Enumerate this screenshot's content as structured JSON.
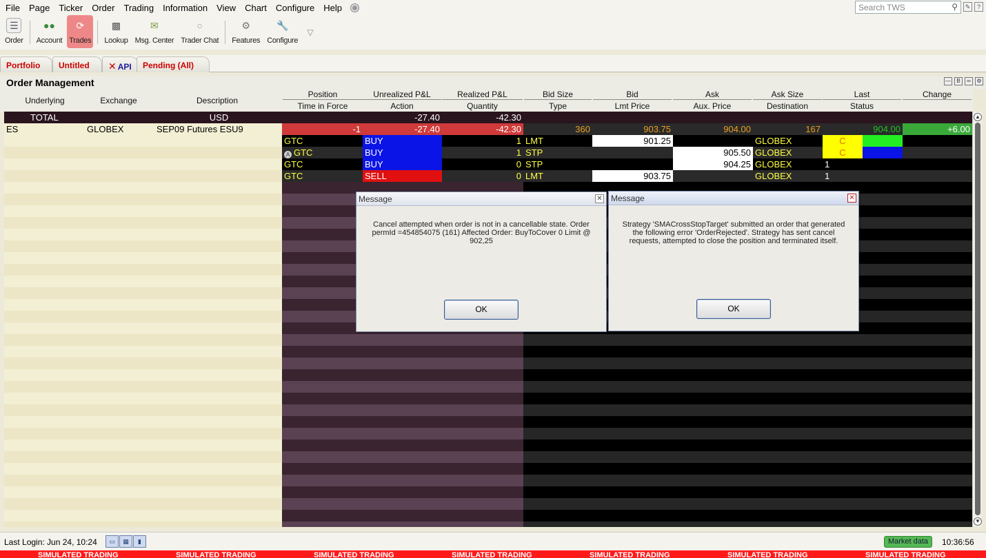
{
  "menu": [
    "File",
    "Page",
    "Ticker",
    "Order",
    "Trading",
    "Information",
    "View",
    "Chart",
    "Configure",
    "Help"
  ],
  "search": {
    "placeholder": "Search TWS"
  },
  "toolbar": [
    {
      "label": "Order",
      "icon": "order-icon",
      "active": false
    },
    {
      "label": "Account",
      "icon": "account-icon",
      "active": false
    },
    {
      "label": "Trades",
      "icon": "trades-icon",
      "active": true
    },
    {
      "label": "Lookup",
      "icon": "lookup-icon",
      "active": false
    },
    {
      "label": "Msg. Center",
      "icon": "message-center-icon",
      "active": false
    },
    {
      "label": "Trader Chat",
      "icon": "chat-icon",
      "active": false
    },
    {
      "label": "Features",
      "icon": "features-icon",
      "active": false
    },
    {
      "label": "Configure",
      "icon": "configure-icon",
      "active": false
    }
  ],
  "tabs": [
    "Portfolio",
    "Untitled",
    "API",
    "Pending (All)"
  ],
  "panel_title": "Order Management",
  "columns": {
    "underlying": "Underlying",
    "exchange": "Exchange",
    "description": "Description",
    "position": "Position",
    "time_in_force": "Time in Force",
    "unrealized": "Unrealized P&L",
    "action": "Action",
    "realized": "Realized P&L",
    "quantity": "Quantity",
    "bid_size": "Bid Size",
    "type": "Type",
    "bid": "Bid",
    "lmt_price": "Lmt Price",
    "ask": "Ask",
    "aux_price": "Aux. Price",
    "ask_size": "Ask Size",
    "destination": "Destination",
    "last": "Last",
    "status": "Status",
    "change": "Change"
  },
  "total_row": {
    "label": "TOTAL",
    "currency": "USD",
    "unrealized": "-27.40",
    "realized": "-42.30"
  },
  "instrument_row": {
    "underlying": "ES",
    "exchange": "GLOBEX",
    "description": "SEP09 Futures ESU9",
    "position": "-1",
    "unrealized": "-27.40",
    "realized": "-42.30",
    "bid_size": "360",
    "bid": "903.75",
    "ask": "904.00",
    "ask_size": "167",
    "last": "904.00",
    "change": "+6.00"
  },
  "orders": [
    {
      "tif": "GTC",
      "action": "BUY",
      "qty": "1",
      "type": "LMT",
      "lmt": "901.25",
      "aux": "",
      "dest": "GLOBEX",
      "status": "C",
      "has_icon": false
    },
    {
      "tif": "GTC",
      "action": "BUY",
      "qty": "1",
      "type": "STP",
      "lmt": "",
      "aux": "905.50",
      "dest": "GLOBEX",
      "status": "C",
      "has_icon": true
    },
    {
      "tif": "GTC",
      "action": "BUY",
      "qty": "0",
      "type": "STP",
      "lmt": "",
      "aux": "904.25",
      "dest": "GLOBEX",
      "status": "1",
      "has_icon": false
    },
    {
      "tif": "GTC",
      "action": "SELL",
      "qty": "0",
      "type": "LMT",
      "lmt": "903.75",
      "aux": "",
      "dest": "GLOBEX",
      "status": "1",
      "has_icon": false
    }
  ],
  "dialog1": {
    "title": "Message",
    "text": "Cancel attempted when order is not in a cancellable state.  Order permId =454854075 (161) Affected Order: BuyToCover 0 Limit @ 902,25",
    "ok": "OK"
  },
  "dialog2": {
    "title": "Message",
    "text": "Strategy 'SMACrossStopTarget' submitted an order that generated the following error 'OrderRejected'. Strategy has sent cancel requests, attempted to close the position and terminated itself.",
    "ok": "OK"
  },
  "status": {
    "last_login": "Last Login: Jun 24, 10:24",
    "market_data": "Market data",
    "clock": "10:36:56",
    "sim_label": "SIMULATED TRADING"
  },
  "colors": {
    "buy": "#0a14e6",
    "sell": "#e01010",
    "negative_bg": "#d03a3a",
    "last_green": "#22c222",
    "change_green": "#3aa93a",
    "status_yellow": "#ffff00",
    "text_yellow": "#ffff44",
    "text_orange": "#e8a020",
    "sim_red": "#ff1a1a"
  }
}
